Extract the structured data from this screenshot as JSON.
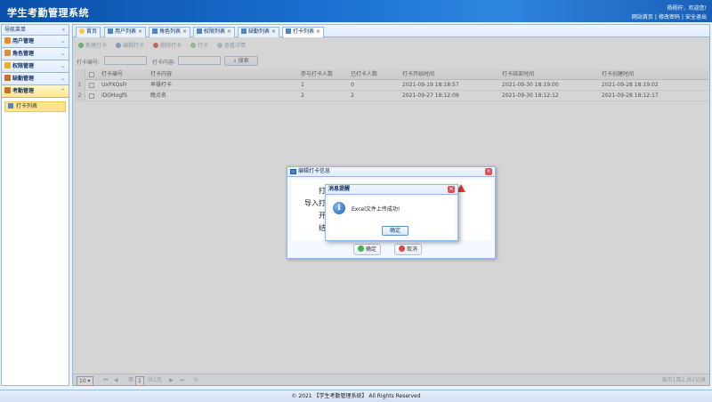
{
  "header": {
    "title": "学生考勤管理系统",
    "welcome": "杨杨柠，欢迎您!",
    "links": [
      "网站首页",
      "修改密码",
      "安全退出"
    ]
  },
  "sidebar": {
    "heading": "导航菜单",
    "collapse_glyph": "«",
    "sections": [
      {
        "label": "用户管理",
        "icon": "users-icon",
        "color": "#e88a2e"
      },
      {
        "label": "角色管理",
        "icon": "role-icon",
        "color": "#d8913a"
      },
      {
        "label": "权限管理",
        "icon": "key-icon",
        "color": "#e6b030"
      },
      {
        "label": "缺勤管理",
        "icon": "absence-icon",
        "color": "#c8702a"
      },
      {
        "label": "考勤管理",
        "icon": "attendance-icon",
        "color": "#c8702a"
      }
    ],
    "active_item": "打卡列表"
  },
  "tabs": [
    {
      "label": "首页",
      "closable": false
    },
    {
      "label": "用户列表",
      "closable": true
    },
    {
      "label": "角色列表",
      "closable": true
    },
    {
      "label": "权限列表",
      "closable": true
    },
    {
      "label": "缺勤列表",
      "closable": true
    },
    {
      "label": "打卡列表",
      "closable": true,
      "active": true
    }
  ],
  "toolbar": {
    "add": "新建打卡",
    "edit": "编辑打卡",
    "delete": "删除打卡",
    "punch": "打卡",
    "detail": "查看详情"
  },
  "search": {
    "code_label": "打卡编号:",
    "content_label": "打卡内容:",
    "button": "搜索"
  },
  "grid": {
    "columns": [
      "打卡编号",
      "打卡内容",
      "参与打卡人数",
      "已打卡人数",
      "打卡开始时间",
      "打卡结束时间",
      "打卡创建时间"
    ],
    "rows": [
      [
        "1",
        "UxPXQsFr",
        "早操打卡",
        "1",
        "0",
        "2021-09-19 18:18:57",
        "2021-09-30 18:19:00",
        "2021-09-28 18:19:02"
      ],
      [
        "2",
        "iDOHogfS",
        "晚点名",
        "2",
        "2",
        "2021-09-27 18:12:09",
        "2021-09-30 18:12:12",
        "2021-09-28 18:12:17"
      ]
    ]
  },
  "pager": {
    "page_size": "10",
    "page_label": "第",
    "page_value": "1",
    "total_pages": "共1页",
    "summary": "显示1到2,共2记录"
  },
  "dialog": {
    "title": "编辑打卡信息",
    "labels": [
      "打",
      "导入打",
      "开",
      "结"
    ],
    "ok": "确定",
    "cancel": "取消"
  },
  "message": {
    "title": "消息提醒",
    "text": "Excel文件上传成功!",
    "ok": "确定"
  },
  "footer": "© 2021 【学生考勤管理系统】 All Rights Reserved"
}
